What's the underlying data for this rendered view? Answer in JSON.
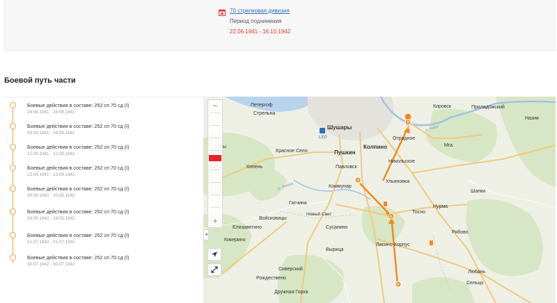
{
  "unit_card": {
    "unit_name": "70 стрелковая дивизия",
    "period_label": "Период подчинения",
    "period_value": "22.06.1941 - 16.10.1942",
    "accent_color": "#e0312f"
  },
  "section": {
    "title": "Боевой путь части"
  },
  "timeline": {
    "line_color": "#f0a23b",
    "items": [
      {
        "title": "Боевые действия в составе: 252 сп 70 сд (I)",
        "date": "24.08.1941 - 24.08.1941"
      },
      {
        "title": "Боевые действия в составе: 252 сп 70 сд (I)",
        "date": "03.09.1941 - 04.09.1941"
      },
      {
        "title": "Боевые действия в составе: 252 сп 70 сд (I)",
        "date": "12.09.1941 - 12.09.1941"
      },
      {
        "title": "Боевые действия в составе: 252 сп 70 сд (I)",
        "date": "13.09.1941 - 13.09.1941"
      },
      {
        "title": "Боевые действия в составе: 252 сп 70 сд (I)",
        "date": "20.05.1942 - 20.05.1942"
      },
      {
        "title": "Боевые действия в составе: 252 сп 70 сд (I)",
        "date": "24.05.1942 - 24.05.1942"
      },
      {
        "title": "Боевые действия в составе: 252 сп 70 сд (I)",
        "date": "01.07.1942 - 01.07.1942"
      },
      {
        "title": "Боевые действия в составе: 252 сп 70 сд (I)",
        "date": "30.07.1942 - 30.07.1942"
      }
    ]
  },
  "map": {
    "zoom_in": "+",
    "zoom_out": "−",
    "route_color": "#f08a1c",
    "place_labels": {
      "petergof": "Петергоф",
      "strelna": "Стрельна",
      "kirovsk": "Кировск",
      "priladozhsky": "Приладожский",
      "naziya": "Назия",
      "shushary": "Шушары",
      "led": "LED",
      "pushkin": "Пушкин",
      "kolpino": "Колпино",
      "otradnoe": "Отрадное",
      "mga": "Мга",
      "krasnoe_selo": "Красное Село",
      "kipen": "Кипень",
      "pavlovsk": "Павловск",
      "nikolskoe": "Никольское",
      "kommunar": "Коммунар",
      "ulyanovka": "Ульяновка",
      "shapki": "Шапки",
      "gatchina": "Гатчина",
      "tosno": "Тосно",
      "nurma": "Нурма",
      "voiskovitsy": "Войсковицы",
      "novy_svet": "Новый Свет",
      "elizavetino": "Елизаветино",
      "susanino": "Сусанино",
      "kikerino": "Кикерино",
      "lisino": "Лисино-Корпус",
      "ryabovo": "Рябово",
      "vyritsa": "Вырица",
      "siversky": "Сиверский",
      "lyuban": "Любань",
      "selco": "Сельцо",
      "rozhdestveno": "Рождествено",
      "druzhnaya_gorka": "Дружная Горка",
      "ropsha_partial": "цы",
      "neva": "р. Нева",
      "izhora": "р. Ижора"
    }
  }
}
